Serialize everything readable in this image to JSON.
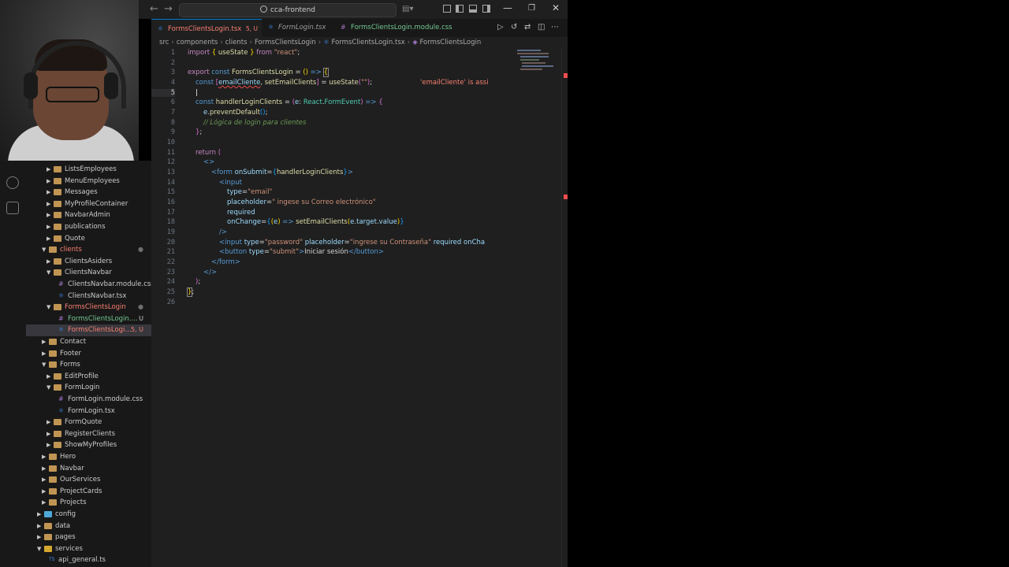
{
  "titlebar": {
    "search_text": "cca-frontend"
  },
  "tabs": [
    {
      "label": "FormsClientsLogin.tsx",
      "status": "5, U",
      "active": true
    },
    {
      "label": "FormLogin.tsx",
      "status": "",
      "active": false
    },
    {
      "label": "FormsClientsLogin.module.css",
      "status": "U",
      "active": false
    }
  ],
  "breadcrumb": [
    "src",
    "components",
    "clients",
    "FormsClientsLogin",
    "FormsClientsLogin.tsx",
    "FormsClientsLogin"
  ],
  "explorer": {
    "items": [
      {
        "label": "ListsEmployees",
        "depth": 2,
        "type": "folder",
        "open": false
      },
      {
        "label": "MenuEmployees",
        "depth": 2,
        "type": "folder",
        "open": false
      },
      {
        "label": "Messages",
        "depth": 2,
        "type": "folder",
        "open": false
      },
      {
        "label": "MyProfileContainer",
        "depth": 2,
        "type": "folder",
        "open": false
      },
      {
        "label": "NavbarAdmin",
        "depth": 2,
        "type": "folder",
        "open": false
      },
      {
        "label": "publications",
        "depth": 2,
        "type": "folder",
        "open": false
      },
      {
        "label": "Quote",
        "depth": 2,
        "type": "folder",
        "open": false
      },
      {
        "label": "clients",
        "depth": 1,
        "type": "folder",
        "open": true,
        "modified": true
      },
      {
        "label": "ClientsAsiders",
        "depth": 2,
        "type": "folder",
        "open": false
      },
      {
        "label": "ClientsNavbar",
        "depth": 2,
        "type": "folder",
        "open": true
      },
      {
        "label": "ClientsNavbar.module.css",
        "depth": 3,
        "type": "css"
      },
      {
        "label": "ClientsNavbar.tsx",
        "depth": 3,
        "type": "tsx"
      },
      {
        "label": "FormsClientsLogin",
        "depth": 2,
        "type": "folder",
        "open": true,
        "modified": true
      },
      {
        "label": "FormsClientsLogin....",
        "depth": 3,
        "type": "css",
        "badge": "U",
        "untracked": true
      },
      {
        "label": "FormsClientsLogi...",
        "depth": 3,
        "type": "tsx",
        "badge": "5, U",
        "selected": true,
        "error": true
      },
      {
        "label": "Contact",
        "depth": 1,
        "type": "folder",
        "open": false
      },
      {
        "label": "Footer",
        "depth": 1,
        "type": "folder",
        "open": false
      },
      {
        "label": "Forms",
        "depth": 1,
        "type": "folder",
        "open": true
      },
      {
        "label": "EditProfile",
        "depth": 2,
        "type": "folder",
        "open": false
      },
      {
        "label": "FormLogin",
        "depth": 2,
        "type": "folder",
        "open": true
      },
      {
        "label": "FormLogin.module.css",
        "depth": 3,
        "type": "css"
      },
      {
        "label": "FormLogin.tsx",
        "depth": 3,
        "type": "tsx"
      },
      {
        "label": "FormQuote",
        "depth": 2,
        "type": "folder",
        "open": false
      },
      {
        "label": "RegisterClients",
        "depth": 2,
        "type": "folder",
        "open": false
      },
      {
        "label": "ShowMyProfiles",
        "depth": 2,
        "type": "folder",
        "open": false
      },
      {
        "label": "Hero",
        "depth": 1,
        "type": "folder",
        "open": false
      },
      {
        "label": "Navbar",
        "depth": 1,
        "type": "folder",
        "open": false
      },
      {
        "label": "OurServices",
        "depth": 1,
        "type": "folder",
        "open": false
      },
      {
        "label": "ProjectCards",
        "depth": 1,
        "type": "folder",
        "open": false
      },
      {
        "label": "Projects",
        "depth": 1,
        "type": "folder",
        "open": false
      },
      {
        "label": "config",
        "depth": 0,
        "type": "folder-special",
        "open": false
      },
      {
        "label": "data",
        "depth": 0,
        "type": "folder",
        "open": false
      },
      {
        "label": "pages",
        "depth": 0,
        "type": "folder",
        "open": false
      },
      {
        "label": "services",
        "depth": 0,
        "type": "folder",
        "open": true
      },
      {
        "label": "api_general.ts",
        "depth": 1,
        "type": "ts"
      }
    ]
  },
  "editor": {
    "line_numbers": [
      "1",
      "2",
      "3",
      "4",
      "5",
      "6",
      "7",
      "8",
      "9",
      "10",
      "11",
      "12",
      "13",
      "14",
      "15",
      "16",
      "17",
      "18",
      "19",
      "20",
      "21",
      "22",
      "23",
      "24",
      "25",
      "26"
    ],
    "inline_hint": "'emailCliente' is assi"
  },
  "colors": {
    "accent": "#0078d4",
    "untracked": "#73c991",
    "error": "#f88070"
  }
}
